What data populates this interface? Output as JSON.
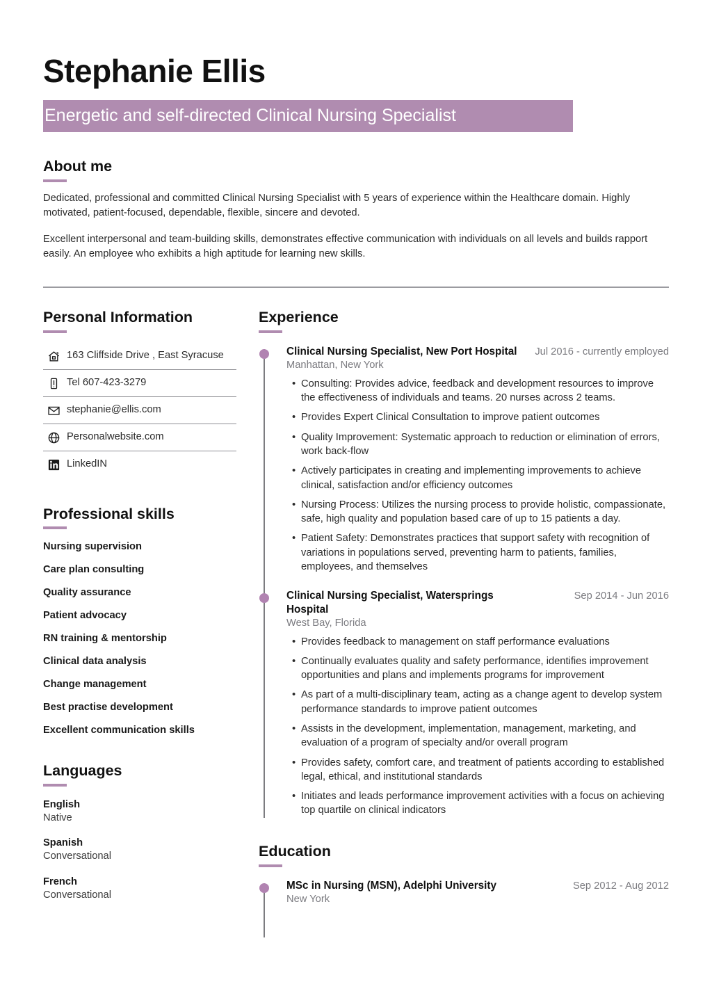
{
  "header": {
    "name": "Stephanie Ellis",
    "tagline": "Energetic and self-directed Clinical Nursing Specialist"
  },
  "about": {
    "heading": "About me",
    "paragraphs": [
      "Dedicated, professional and committed Clinical Nursing Specialist with 5 years of experience within the Healthcare domain. Highly motivated, patient-focused, dependable, flexible, sincere and devoted.",
      "Excellent interpersonal and team-building skills, demonstrates effective communication with individuals on all levels and builds rapport easily. An employee who exhibits a high aptitude for learning new skills."
    ]
  },
  "personal_information": {
    "heading": "Personal Information",
    "items": [
      {
        "icon": "home-icon",
        "text": "163 Cliffside Drive , East Syracuse"
      },
      {
        "icon": "phone-icon",
        "text": "Tel 607-423-3279"
      },
      {
        "icon": "email-icon",
        "text": "stephanie@ellis.com"
      },
      {
        "icon": "globe-icon",
        "text": "Personalwebsite.com"
      },
      {
        "icon": "linkedin-icon",
        "text": "LinkedIN"
      }
    ]
  },
  "professional_skills": {
    "heading": "Professional skills",
    "items": [
      "Nursing supervision",
      "Care plan consulting",
      "Quality assurance",
      "Patient advocacy",
      "RN training & mentorship",
      "Clinical data analysis",
      "Change management",
      "Best practise development",
      "Excellent communication skills"
    ]
  },
  "languages": {
    "heading": "Languages",
    "items": [
      {
        "name": "English",
        "level": "Native"
      },
      {
        "name": "Spanish",
        "level": "Conversational"
      },
      {
        "name": "French",
        "level": "Conversational"
      }
    ]
  },
  "experience": {
    "heading": "Experience",
    "entries": [
      {
        "title": "Clinical Nursing Specialist, New Port Hospital",
        "date": "Jul 2016 - currently employed",
        "place": "Manhattan, New York",
        "bullets": [
          "Consulting: Provides advice, feedback and development resources to improve the effectiveness of individuals and teams. 20 nurses across 2 teams.",
          "Provides Expert Clinical Consultation to improve patient outcomes",
          "Quality Improvement: Systematic approach to reduction or elimination of errors, work back-flow",
          "Actively participates in creating and implementing improvements to achieve clinical, satisfaction and/or efficiency outcomes",
          "Nursing Process: Utilizes the nursing process to provide holistic, compassionate, safe, high quality and population based care of up to 15 patients a day.",
          "Patient Safety: Demonstrates practices that support safety with recognition of variations in populations served, preventing harm to patients, families, employees, and themselves"
        ]
      },
      {
        "title": "Clinical Nursing Specialist, Watersprings Hospital",
        "date": "Sep 2014 - Jun 2016",
        "place": "West Bay, Florida",
        "bullets": [
          "Provides feedback to management on staff performance evaluations",
          "Continually evaluates quality and safety performance, identifies improvement opportunities and plans and implements programs for improvement",
          "As part of a multi-disciplinary team, acting as a change agent to develop system performance standards to improve patient outcomes",
          "Assists in the development, implementation, management, marketing, and evaluation of a program of specialty and/or overall program",
          "Provides safety, comfort care, and treatment of patients according to established legal, ethical, and institutional standards",
          "Initiates and leads performance improvement activities with a focus on achieving top quartile on clinical indicators"
        ]
      }
    ]
  },
  "education": {
    "heading": "Education",
    "entries": [
      {
        "title": "MSc in Nursing (MSN), Adelphi University",
        "date": "Sep 2012 - Aug 2012",
        "place": "New York"
      }
    ]
  },
  "colors": {
    "accent": "#b08cb0",
    "dot": "#b183b1",
    "muted_text": "#7b7b80",
    "rule": "#9b9ba0"
  }
}
